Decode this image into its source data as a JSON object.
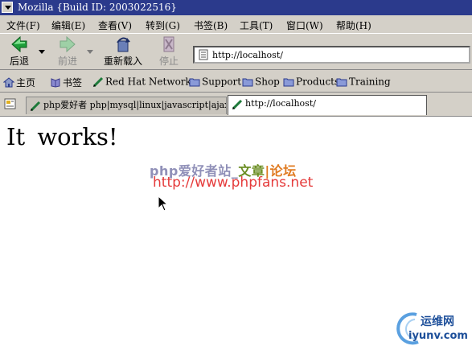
{
  "window": {
    "title": "Mozilla {Build ID: 2003022516}"
  },
  "menu": [
    "文件(F)",
    "编辑(E)",
    "查看(V)",
    "转到(G)",
    "书签(B)",
    "工具(T)",
    "窗口(W)",
    "帮助(H)"
  ],
  "nav": {
    "back": "后退",
    "forward": "前进",
    "reload": "重新载入",
    "stop": "停止",
    "url": "http://localhost/"
  },
  "bookmarks": {
    "home": "主页",
    "bookmarks": "书签",
    "redhat": "Red  Hat  Network",
    "support": "Support",
    "shop": "Shop",
    "products": "Products",
    "training": "Training"
  },
  "tabs": [
    {
      "label": "php爱好者  php|mysql|linux|javascript|ajax..."
    },
    {
      "label": "http://localhost/"
    }
  ],
  "page": {
    "heading": "It  works!",
    "watermark_site_a": "php爱好者站_",
    "watermark_site_b": "文章",
    "watermark_site_c": "|论坛",
    "watermark_url": "http://www.phpfans.net"
  },
  "logo": {
    "line1": "运维网",
    "line2": "iyunv.com"
  },
  "colors": {
    "titlebar": "#2b3a8c",
    "chrome": "#d4d0c8",
    "watermark_red": "#e53b3b"
  }
}
